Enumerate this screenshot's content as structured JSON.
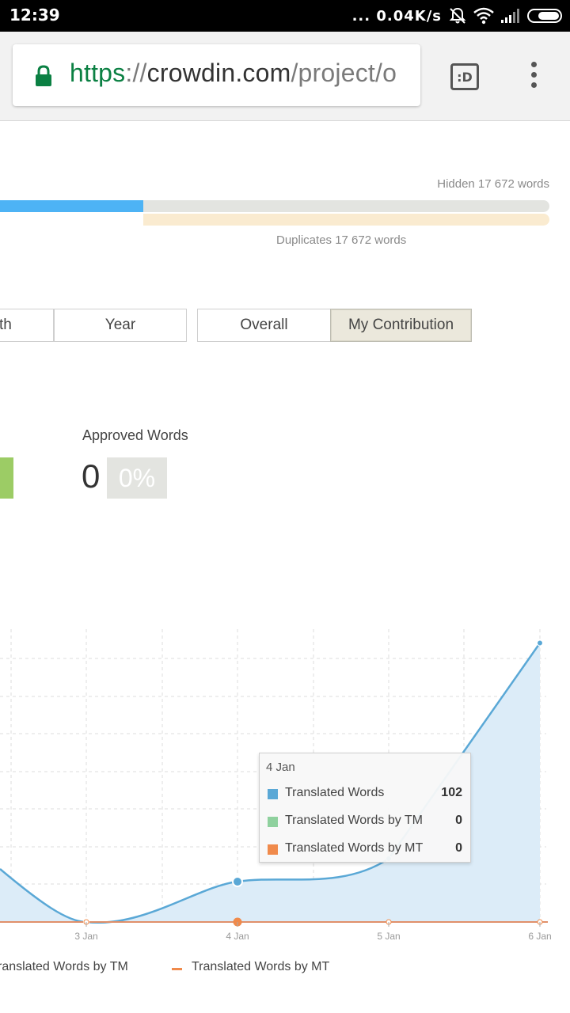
{
  "status_bar": {
    "time": "12:39",
    "network_speed": "... 0.04K/s",
    "icons": [
      "bell-off-icon",
      "wifi-icon",
      "signal-icon",
      "battery-icon"
    ]
  },
  "browser": {
    "url_scheme": "https",
    "url_sep": "://",
    "url_host": "crowdin.com",
    "url_path": "/project/o",
    "tab_label": ":D"
  },
  "progress": {
    "hidden_label": "Hidden 17 672 words",
    "duplicates_label": "Duplicates 17 672 words",
    "colors": {
      "translated": "#4db3f5",
      "track": "#e3e4e0",
      "duplicates": "#faebd0"
    }
  },
  "period_buttons": [
    {
      "label": "th"
    },
    {
      "label": "Year"
    }
  ],
  "mode_buttons": [
    {
      "label": "Overall",
      "active": false
    },
    {
      "label": "My Contribution",
      "active": true
    }
  ],
  "approved": {
    "label": "Approved Words",
    "value": "0",
    "percent": "0%"
  },
  "chart_data": {
    "type": "area",
    "x": [
      "3 Jan",
      "4 Jan",
      "5 Jan",
      "6 Jan"
    ],
    "series": [
      {
        "name": "Translated Words",
        "color": "#5aa8d6",
        "values": [
          0,
          102,
          160,
          705
        ]
      },
      {
        "name": "Translated Words by TM",
        "color": "#8fd19e",
        "values": [
          0,
          0,
          0,
          0
        ]
      },
      {
        "name": "Translated Words by MT",
        "color": "#f08a4b",
        "values": [
          0,
          0,
          0,
          0
        ]
      }
    ],
    "grid": true,
    "legend": "bottom",
    "tooltip": {
      "date": "4 Jan",
      "rows": [
        {
          "name": "Translated Words",
          "color": "#5aa8d6",
          "value": "102"
        },
        {
          "name": "Translated Words by TM",
          "color": "#8fd19e",
          "value": "0"
        },
        {
          "name": "Translated Words by MT",
          "color": "#f08a4b",
          "value": "0"
        }
      ]
    },
    "legend_items": [
      {
        "label": "ranslated Words by TM"
      },
      {
        "label": "Translated Words by MT"
      }
    ]
  }
}
